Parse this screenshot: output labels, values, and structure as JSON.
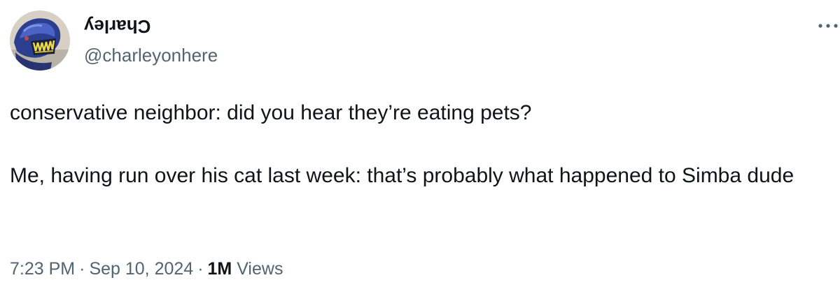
{
  "author": {
    "display_name": "Charley",
    "handle": "@charleyonhere",
    "avatar_icon": "alien-creature-avatar"
  },
  "menu": {
    "more_icon": "more-dots-icon"
  },
  "tweet": {
    "line1": "conservative neighbor: did you hear they’re eating pets?",
    "line2": "Me, having run over his cat last week: that’s probably what happened to Simba dude"
  },
  "meta": {
    "time": "7:23 PM",
    "separator": "·",
    "date": "Sep 10, 2024",
    "views_count": "1M",
    "views_label": "Views"
  },
  "colors": {
    "text": "#0f1419",
    "secondary": "#536471",
    "background": "#ffffff"
  }
}
